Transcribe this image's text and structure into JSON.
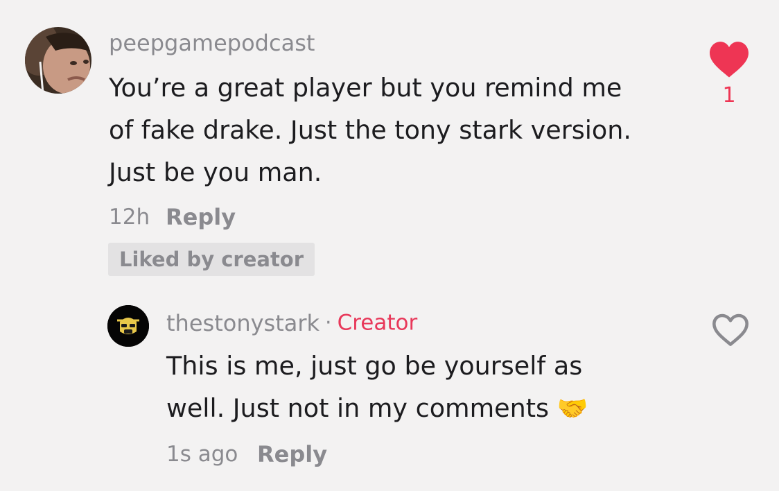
{
  "comment": {
    "username": "peepgamepodcast",
    "text_lines": [
      "You’re a great player but you remind me",
      "of fake drake. Just the tony stark version.",
      "Just be you man."
    ],
    "time": "12h",
    "reply_label": "Reply",
    "liked_badge": "Liked by creator",
    "like_count": "1",
    "liked": true,
    "accent_color": "#ee3554"
  },
  "reply": {
    "username": "thestonystark",
    "separator": "·",
    "badge": "Creator",
    "badge_color": "#e8385a",
    "text_lines": [
      "This is me, just go be yourself as",
      "well. Just not in my comments"
    ],
    "emoji": "🤝",
    "emoji_name": "handshake-icon",
    "time": "1s ago",
    "reply_label": "Reply",
    "liked": false
  }
}
